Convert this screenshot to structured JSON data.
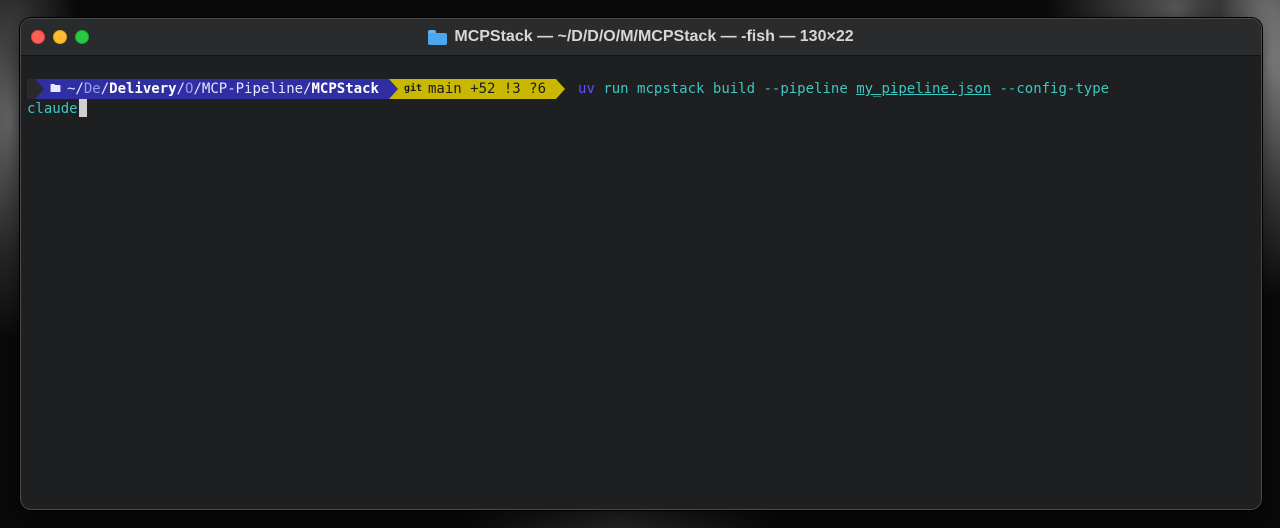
{
  "window": {
    "title": "MCPStack — ~/D/D/O/M/MCPStack — -fish — 130×22"
  },
  "prompt": {
    "apple_glyph": "",
    "folder_glyph": "🖿",
    "path_home": "~/",
    "path_dim1": "De",
    "path_sep1": "/",
    "path_bold1": "Delivery",
    "path_sep2": "/",
    "path_dim2": "O",
    "path_sep3": "/",
    "path_mid": "MCP-Pipeline",
    "path_sep4": "/",
    "path_bold2": "MCPStack",
    "git_icon": "git",
    "git_status": "main +52 !3 ?6"
  },
  "command": {
    "program": "uv",
    "args_before": "run mcpstack build --pipeline",
    "file": "my_pipeline.json",
    "args_after": "--config-type",
    "wrapped": "claude"
  },
  "colors": {
    "path_segment": "#2f2fa3",
    "git_segment": "#c9b800",
    "command_text": "#3cc7c1",
    "program_text": "#5a55ff"
  }
}
